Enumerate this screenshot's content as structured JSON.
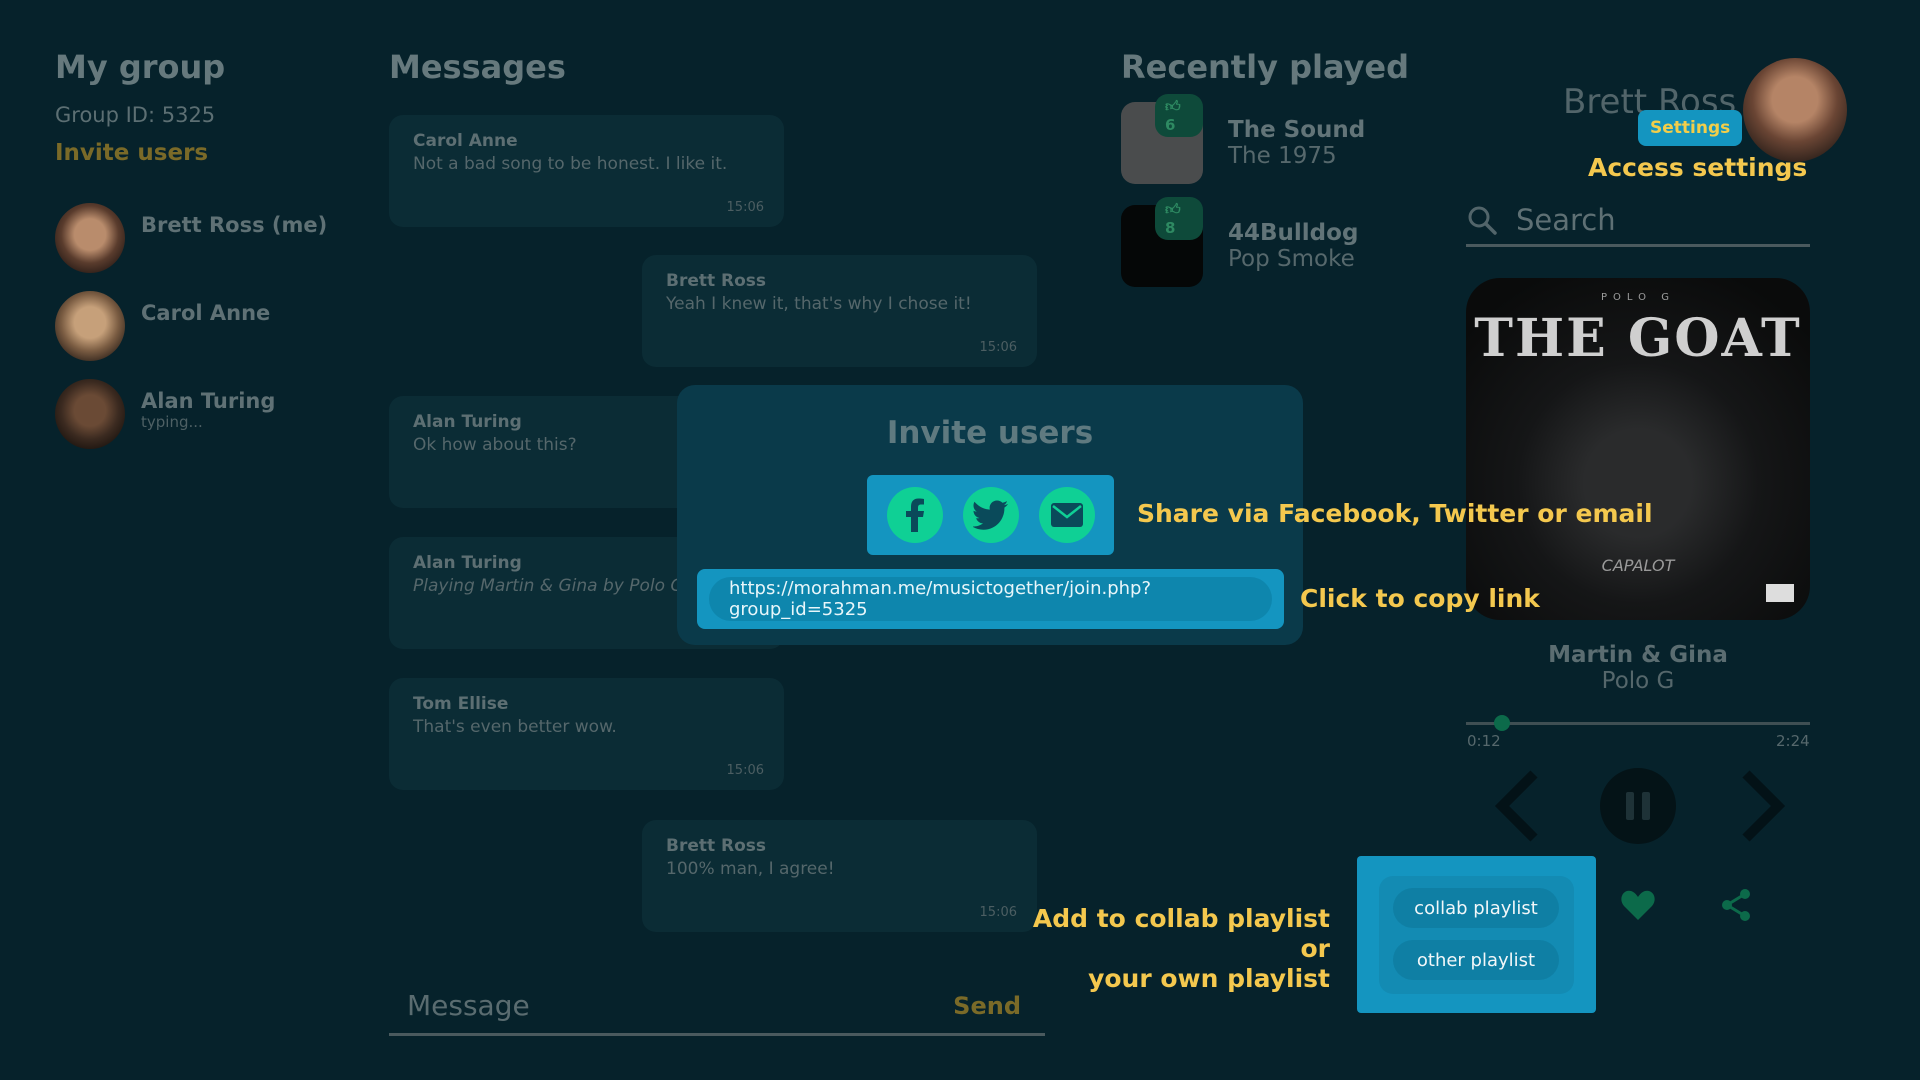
{
  "group": {
    "title": "My group",
    "group_id": "Group ID: 5325",
    "invite_label": "Invite users",
    "members": [
      {
        "name": "Brett Ross (me)",
        "status": ""
      },
      {
        "name": "Carol Anne",
        "status": ""
      },
      {
        "name": "Alan Turing",
        "status": "typing..."
      }
    ]
  },
  "messages": {
    "title": "Messages",
    "items": [
      {
        "from": "Carol Anne",
        "text": "Not a bad song to be honest. I like it.",
        "time": "15:06"
      },
      {
        "from": "Brett Ross",
        "text": "Yeah I knew it, that's why I chose it!",
        "time": "15:06"
      },
      {
        "from": "Alan Turing",
        "text": "Ok how about this?",
        "time": ""
      },
      {
        "from": "Alan Turing",
        "text": "Playing Martin & Gina by Polo G",
        "time": ""
      },
      {
        "from": "Tom Ellise",
        "text": "That's even better wow.",
        "time": "15:06"
      },
      {
        "from": "Brett Ross",
        "text": "100% man, I agree!",
        "time": "15:06"
      }
    ],
    "input_placeholder": "Message",
    "send_label": "Send"
  },
  "recent": {
    "title": "Recently played",
    "tracks": [
      {
        "title": "The Sound",
        "artist": "The 1975",
        "likes": "6"
      },
      {
        "title": "44Bulldog",
        "artist": "Pop Smoke",
        "likes": "8"
      }
    ]
  },
  "profile": {
    "name": "Brett Ross",
    "settings_label": "Settings",
    "settings_callout": "Access settings"
  },
  "search": {
    "placeholder": "Search"
  },
  "player": {
    "album_brand": "POLO G",
    "album_title": "THE GOAT",
    "album_script": "CAPALOT",
    "title": "Martin & Gina",
    "artist": "Polo G",
    "elapsed": "0:12",
    "duration": "2:24",
    "progress": 0.08
  },
  "invite_modal": {
    "title": "Invite users",
    "share_callout": "Share via Facebook, Twitter or email",
    "link": "https://morahman.me/musictogether/join.php?group_id=5325",
    "copy_callout": "Click to copy link"
  },
  "playlist_menu": {
    "callout_line1": "Add to collab playlist or",
    "callout_line2": "your own playlist",
    "options": [
      "collab playlist",
      "other playlist"
    ]
  },
  "colors": {
    "background": "#06222b",
    "accent_blue": "#1495c0",
    "accent_green": "#0fd095",
    "callout_yellow": "#f4c84e"
  }
}
